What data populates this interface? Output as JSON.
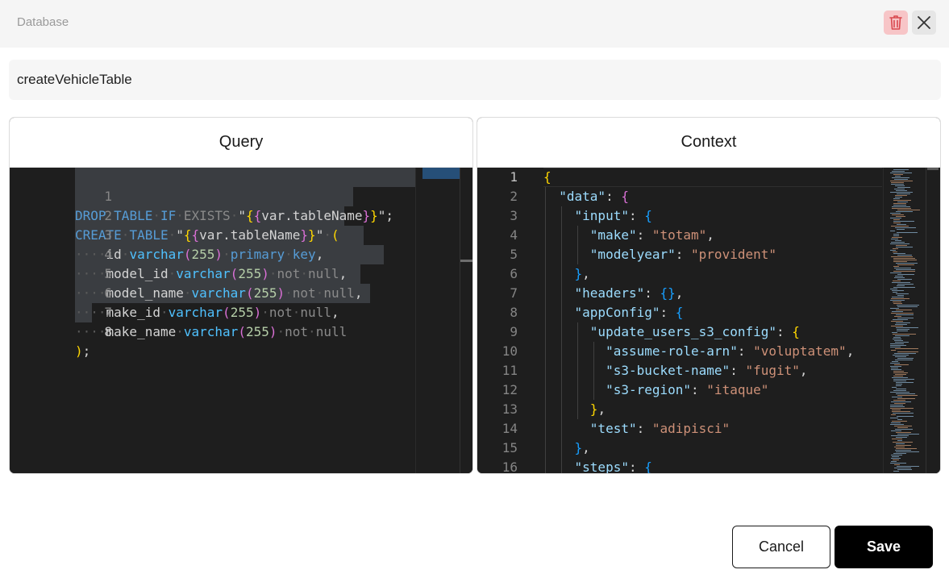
{
  "header": {
    "breadcrumb": "Database",
    "delete_icon": "trash-icon",
    "close_icon": "close-icon"
  },
  "query_name": {
    "value": "createVehicleTable"
  },
  "query_panel": {
    "title": "Query",
    "lines": [
      {
        "n": "1"
      },
      {
        "n": "2"
      },
      {
        "n": "3"
      },
      {
        "n": "4"
      },
      {
        "n": "5"
      },
      {
        "n": "6"
      },
      {
        "n": "7"
      },
      {
        "n": "8"
      }
    ]
  },
  "context_panel": {
    "title": "Context",
    "lines": [
      {
        "n": "1"
      },
      {
        "n": "2"
      },
      {
        "n": "3"
      },
      {
        "n": "4"
      },
      {
        "n": "5"
      },
      {
        "n": "6"
      },
      {
        "n": "7"
      },
      {
        "n": "8"
      },
      {
        "n": "9"
      },
      {
        "n": "10"
      },
      {
        "n": "11"
      },
      {
        "n": "12"
      },
      {
        "n": "13"
      },
      {
        "n": "14"
      },
      {
        "n": "15"
      },
      {
        "n": "16"
      }
    ]
  },
  "actions": {
    "cancel_label": "Cancel",
    "save_label": "Save"
  },
  "colors": {
    "editor_bg": "#1e1e1e",
    "delete_bg": "#f7c5c7",
    "save_bg": "#000000"
  }
}
